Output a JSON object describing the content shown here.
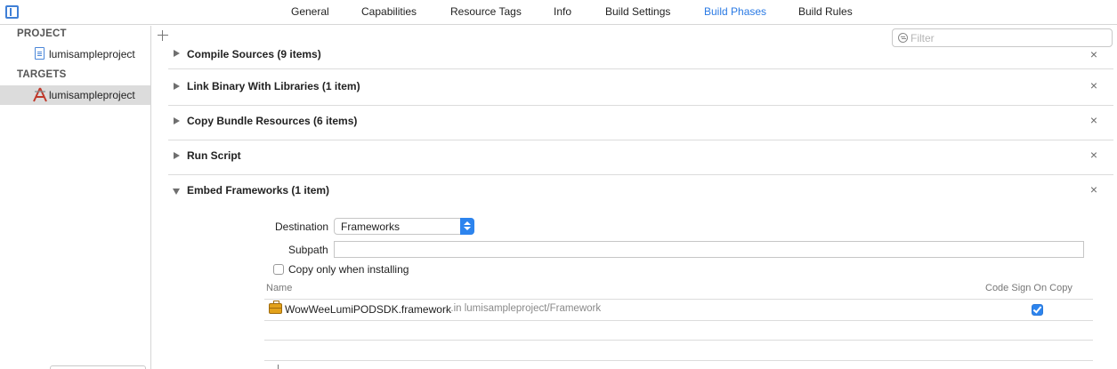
{
  "tabs": [
    {
      "label": "General",
      "active": false
    },
    {
      "label": "Capabilities",
      "active": false
    },
    {
      "label": "Resource Tags",
      "active": false
    },
    {
      "label": "Info",
      "active": false
    },
    {
      "label": "Build Settings",
      "active": false
    },
    {
      "label": "Build Phases",
      "active": true
    },
    {
      "label": "Build Rules",
      "active": false
    }
  ],
  "sidebar": {
    "project_header": "PROJECT",
    "project_item": "lumisampleproject",
    "targets_header": "TARGETS",
    "target_item": "lumisampleproject"
  },
  "filter": {
    "placeholder": "Filter",
    "value": ""
  },
  "phases": [
    {
      "title": "Compile Sources (9 items)",
      "expanded": false
    },
    {
      "title": "Link Binary With Libraries (1 item)",
      "expanded": false
    },
    {
      "title": "Copy Bundle Resources (6 items)",
      "expanded": false
    },
    {
      "title": "Run Script",
      "expanded": false
    },
    {
      "title": "Embed Frameworks (1 item)",
      "expanded": true
    }
  ],
  "close_glyph": "×",
  "embed": {
    "destination_label": "Destination",
    "destination_value": "Frameworks",
    "subpath_label": "Subpath",
    "subpath_value": "",
    "copy_only_label": "Copy only when installing",
    "copy_only_checked": false,
    "col_name": "Name",
    "col_code_sign": "Code Sign On Copy",
    "framework_name": "WowWeeLumiPODSDK.framework",
    "framework_location": "...in lumisampleproject/Framework",
    "code_sign_checked": true
  },
  "colors": {
    "accent": "#2a7ae4",
    "selected_row": "#dcdcdc"
  }
}
